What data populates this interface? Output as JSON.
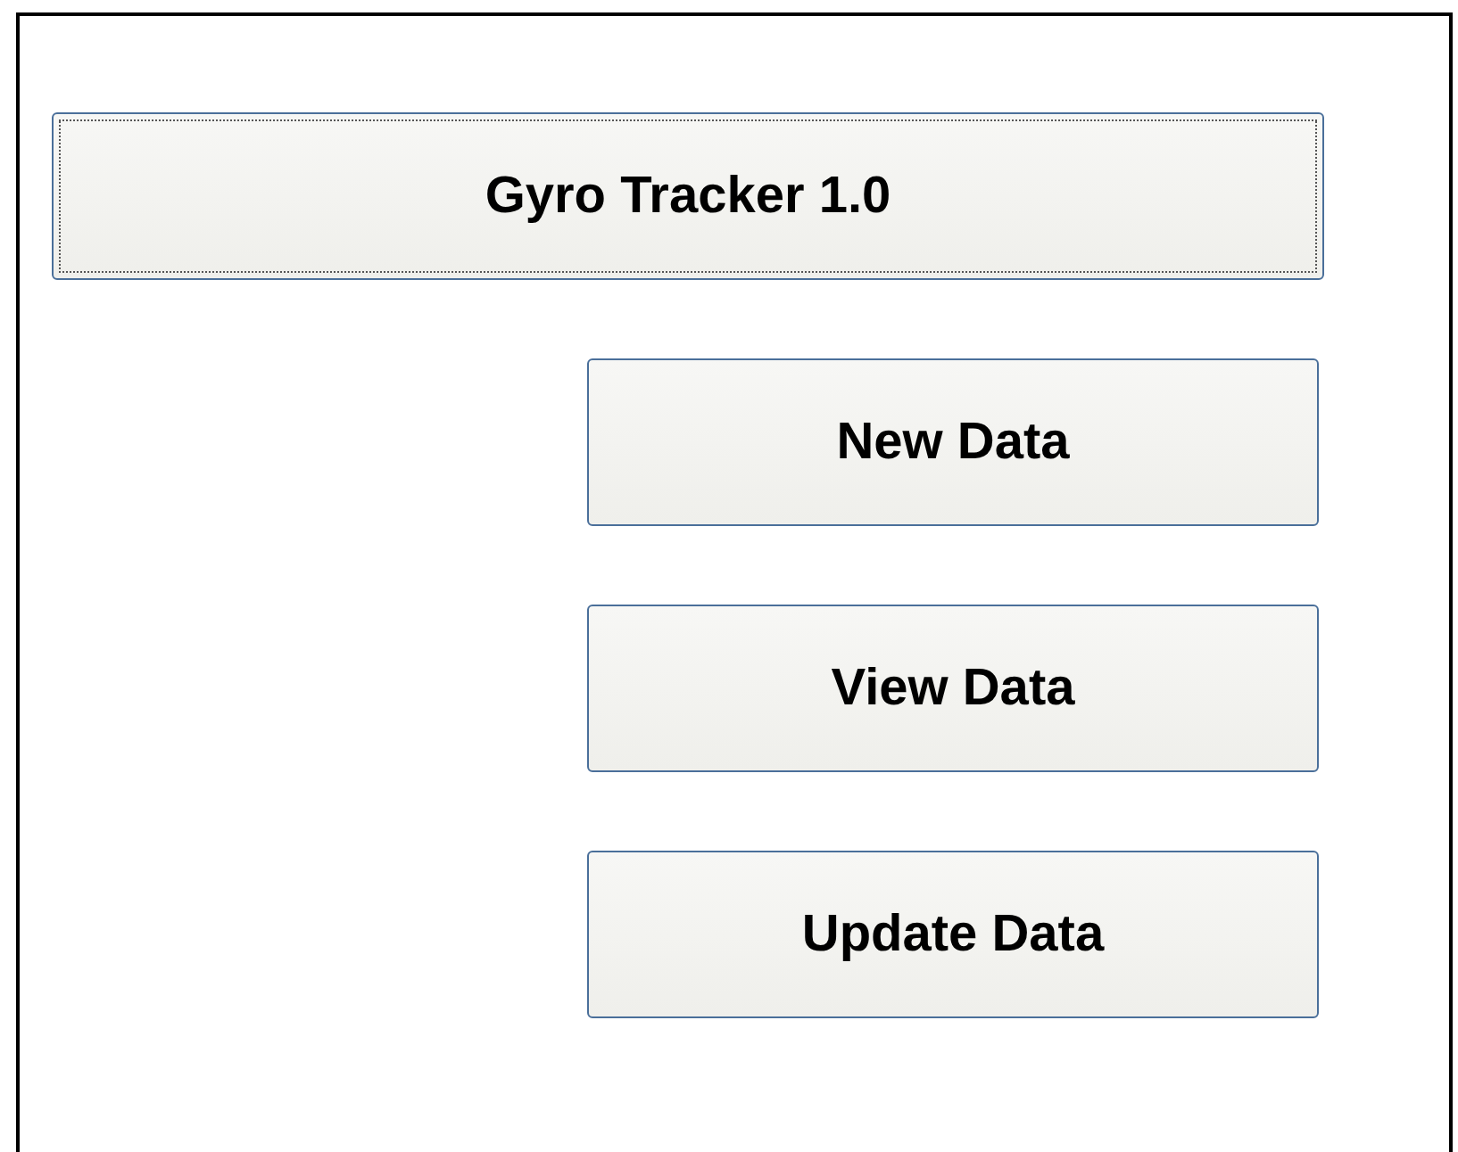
{
  "title_button": {
    "label": "Gyro Tracker 1.0",
    "focused": true
  },
  "buttons": [
    {
      "label": "New Data"
    },
    {
      "label": "View Data"
    },
    {
      "label": "Update Data"
    }
  ]
}
